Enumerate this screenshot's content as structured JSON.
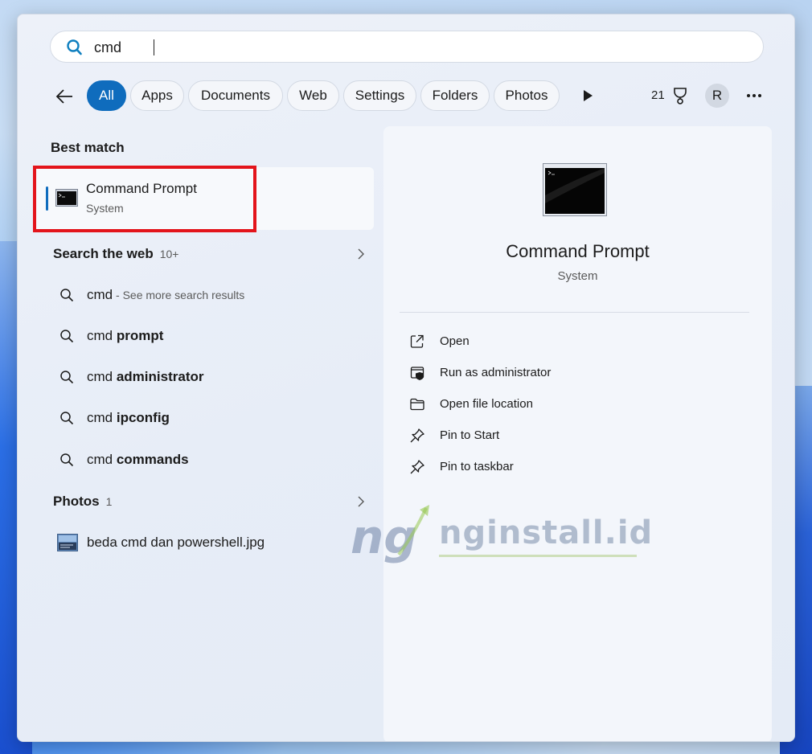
{
  "search": {
    "value": "cmd"
  },
  "filters": {
    "chips": [
      "All",
      "Apps",
      "Documents",
      "Web",
      "Settings",
      "Folders",
      "Photos"
    ],
    "points": "21",
    "avatar_initial": "R"
  },
  "best_match": {
    "heading": "Best match",
    "title": "Command Prompt",
    "subtitle": "System"
  },
  "web": {
    "heading": "Search the web",
    "count": "10+",
    "results": [
      {
        "prefix": "cmd",
        "bold": "",
        "suffix": " - See more search results"
      },
      {
        "prefix": "cmd ",
        "bold": "prompt",
        "suffix": ""
      },
      {
        "prefix": "cmd ",
        "bold": "administrator",
        "suffix": ""
      },
      {
        "prefix": "cmd ",
        "bold": "ipconfig",
        "suffix": ""
      },
      {
        "prefix": "cmd ",
        "bold": "commands",
        "suffix": ""
      }
    ]
  },
  "photos": {
    "heading": "Photos",
    "count": "1",
    "item": "beda cmd dan powershell.jpg"
  },
  "detail": {
    "title": "Command Prompt",
    "subtitle": "System",
    "actions": [
      {
        "label": "Open",
        "icon": "open-external-icon"
      },
      {
        "label": "Run as administrator",
        "icon": "shield-admin-icon"
      },
      {
        "label": "Open file location",
        "icon": "folder-icon"
      },
      {
        "label": "Pin to Start",
        "icon": "pin-icon"
      },
      {
        "label": "Pin to taskbar",
        "icon": "pin-icon"
      }
    ]
  },
  "watermark": {
    "text": "nginstall.id"
  },
  "colors": {
    "accent": "#0f6cbd",
    "highlight": "#e3141b"
  }
}
